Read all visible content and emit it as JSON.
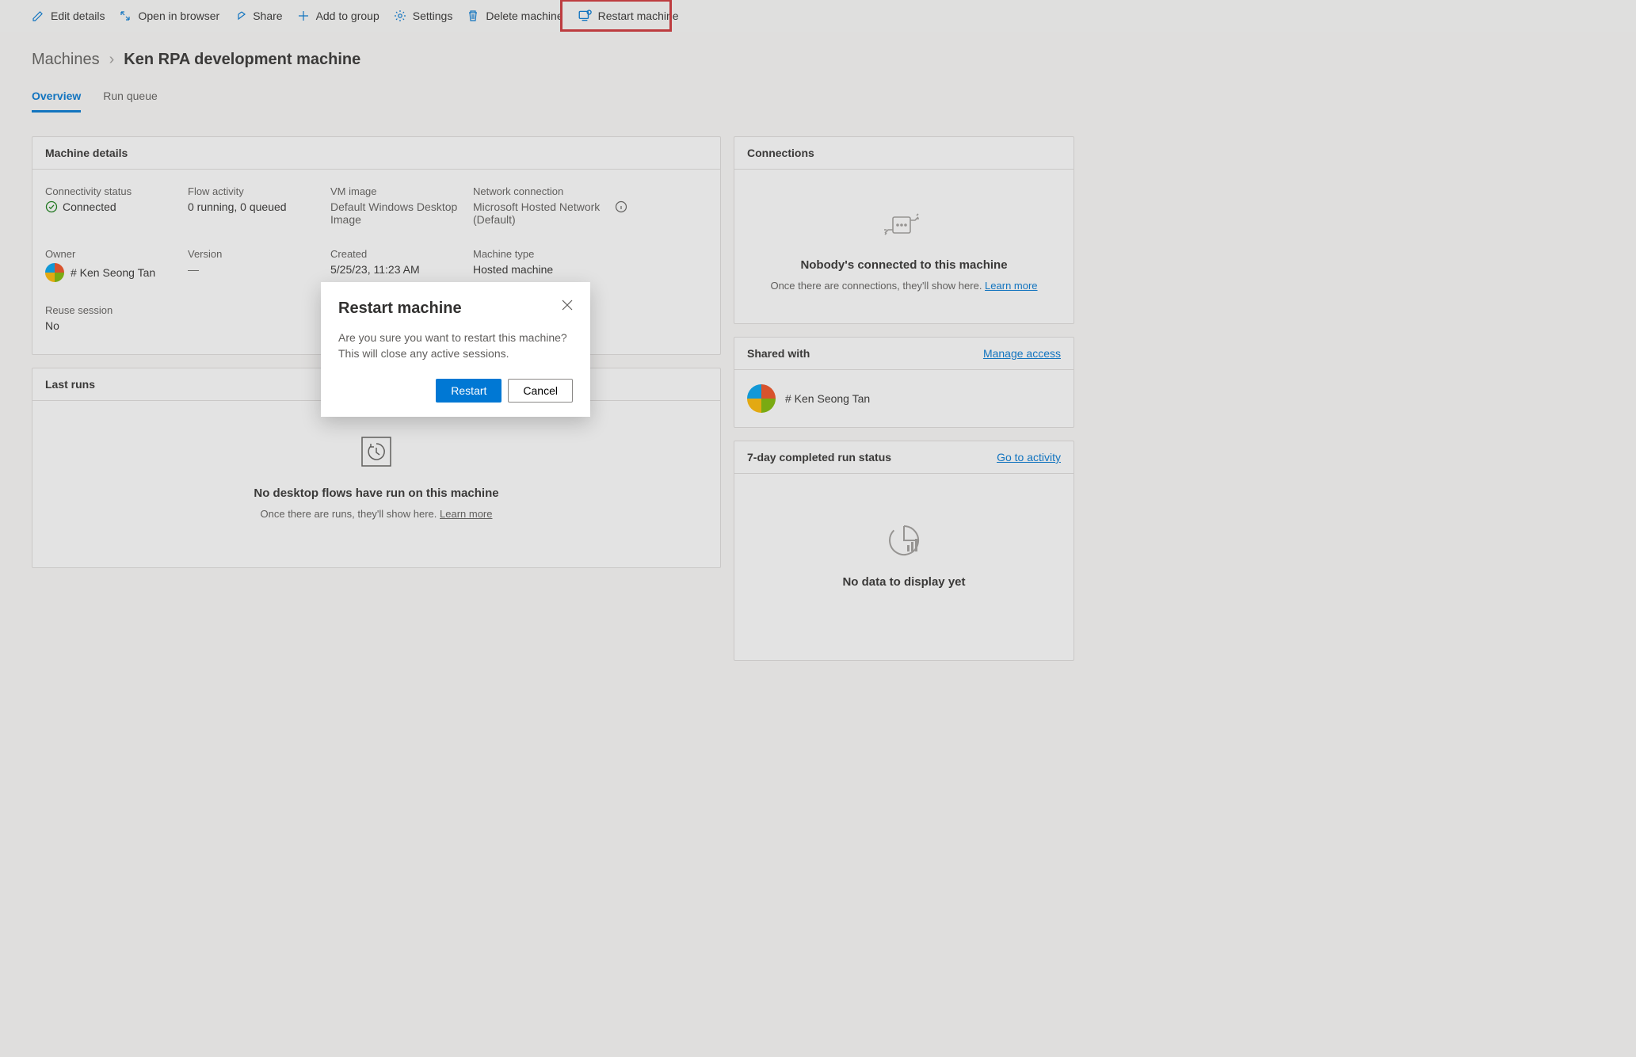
{
  "toolbar": {
    "edit_details": "Edit details",
    "open_browser": "Open in browser",
    "share": "Share",
    "add_to_group": "Add to group",
    "settings": "Settings",
    "delete_machine": "Delete machine",
    "restart_machine": "Restart machine"
  },
  "breadcrumb": {
    "root": "Machines",
    "current": "Ken RPA development machine"
  },
  "tabs": {
    "overview": "Overview",
    "run_queue": "Run queue"
  },
  "machine_details": {
    "heading": "Machine details",
    "connectivity_label": "Connectivity status",
    "connectivity_value": "Connected",
    "flow_activity_label": "Flow activity",
    "flow_activity_value": "0 running, 0 queued",
    "vm_image_label": "VM image",
    "vm_image_value": "Default Windows Desktop Image",
    "network_label": "Network connection",
    "network_value": "Microsoft Hosted Network (Default)",
    "owner_label": "Owner",
    "owner_value": "# Ken Seong Tan",
    "version_label": "Version",
    "version_value": "—",
    "created_label": "Created",
    "created_value": "5/25/23, 11:23 AM",
    "machine_type_label": "Machine type",
    "machine_type_value": "Hosted machine",
    "reuse_label": "Reuse session",
    "reuse_value": "No"
  },
  "last_runs": {
    "heading": "Last runs",
    "empty_title": "No desktop flows have run on this machine",
    "empty_sub": "Once there are runs, they'll show here. ",
    "learn_more": "Learn more"
  },
  "connections": {
    "heading": "Connections",
    "empty_title": "Nobody's connected to this machine",
    "empty_sub": "Once there are connections, they'll show here. ",
    "learn_more": "Learn more"
  },
  "shared_with": {
    "heading": "Shared with",
    "manage_link": "Manage access",
    "user": "# Ken Seong Tan"
  },
  "run_status": {
    "heading": "7-day completed run status",
    "link": "Go to activity",
    "empty_title": "No data to display yet"
  },
  "dialog": {
    "title": "Restart machine",
    "body": "Are you sure you want to restart this machine? This will close any active sessions.",
    "confirm": "Restart",
    "cancel": "Cancel"
  }
}
